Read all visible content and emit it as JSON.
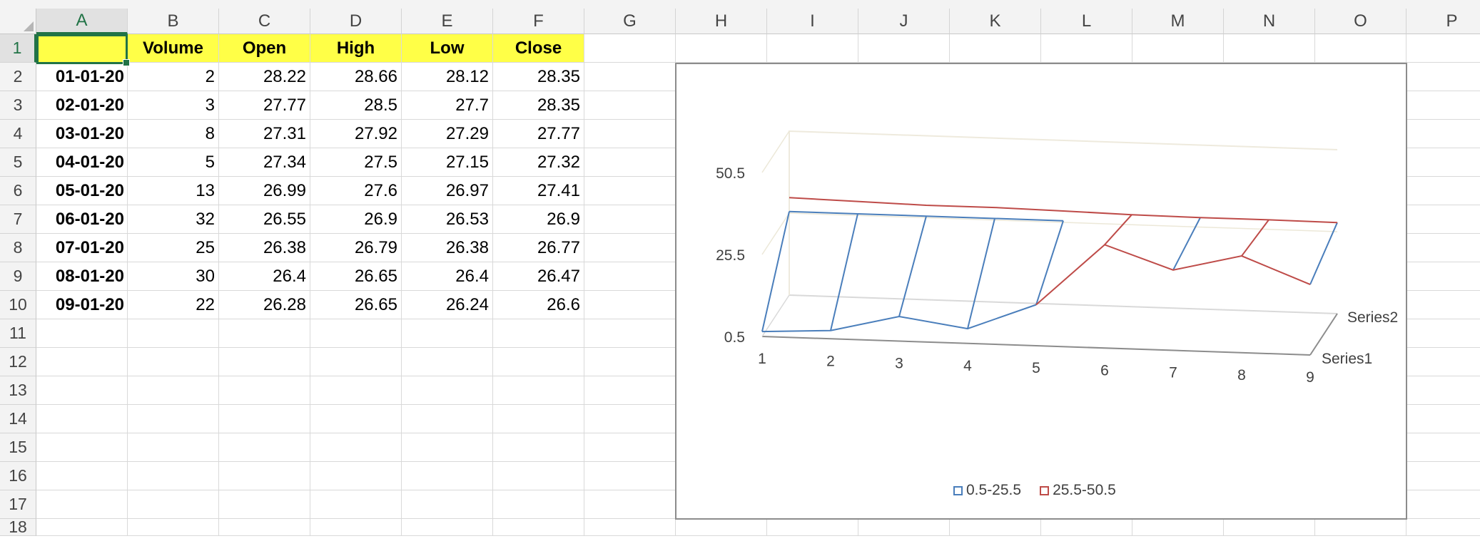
{
  "columns": [
    "A",
    "B",
    "C",
    "D",
    "E",
    "F",
    "G",
    "H",
    "I",
    "J",
    "K",
    "L",
    "M",
    "N",
    "O",
    "P"
  ],
  "rows": [
    "1",
    "2",
    "3",
    "4",
    "5",
    "6",
    "7",
    "8",
    "9",
    "10",
    "11",
    "12",
    "13",
    "14",
    "15",
    "16",
    "17",
    "18"
  ],
  "table": {
    "header": [
      "",
      "Volume",
      "Open",
      "High",
      "Low",
      "Close"
    ],
    "body": [
      [
        "01-01-20",
        "2",
        "28.22",
        "28.66",
        "28.12",
        "28.35"
      ],
      [
        "02-01-20",
        "3",
        "27.77",
        "28.5",
        "27.7",
        "28.35"
      ],
      [
        "03-01-20",
        "8",
        "27.31",
        "27.92",
        "27.29",
        "27.77"
      ],
      [
        "04-01-20",
        "5",
        "27.34",
        "27.5",
        "27.15",
        "27.32"
      ],
      [
        "05-01-20",
        "13",
        "26.99",
        "27.6",
        "26.97",
        "27.41"
      ],
      [
        "06-01-20",
        "32",
        "26.55",
        "26.9",
        "26.53",
        "26.9"
      ],
      [
        "07-01-20",
        "25",
        "26.38",
        "26.79",
        "26.38",
        "26.77"
      ],
      [
        "08-01-20",
        "30",
        "26.4",
        "26.65",
        "26.4",
        "26.47"
      ],
      [
        "09-01-20",
        "22",
        "26.28",
        "26.65",
        "26.24",
        "26.6"
      ]
    ]
  },
  "colors": {
    "header_fill": "#ffff47",
    "selection": "#217346",
    "band_low": "#4a7ebb",
    "band_high": "#be4b48"
  },
  "chart_data": {
    "type": "surface",
    "categories": [
      "1",
      "2",
      "3",
      "4",
      "5",
      "6",
      "7",
      "8",
      "9"
    ],
    "series_names": [
      "Series1",
      "Series2"
    ],
    "z_ticks": [
      "0.5",
      "25.5",
      "50.5"
    ],
    "zlim": [
      0.5,
      50.5
    ],
    "series": [
      {
        "name": "Series1",
        "values": [
          2,
          3,
          8,
          5,
          13,
          32,
          25,
          30,
          22
        ]
      },
      {
        "name": "Series2",
        "values": [
          28.22,
          27.77,
          27.31,
          27.34,
          26.99,
          26.55,
          26.38,
          26.4,
          26.28
        ]
      }
    ],
    "legend": [
      {
        "label": "0.5-25.5",
        "color": "#4a7ebb"
      },
      {
        "label": "25.5-50.5",
        "color": "#be4b48"
      }
    ],
    "legend_position": "bottom"
  }
}
